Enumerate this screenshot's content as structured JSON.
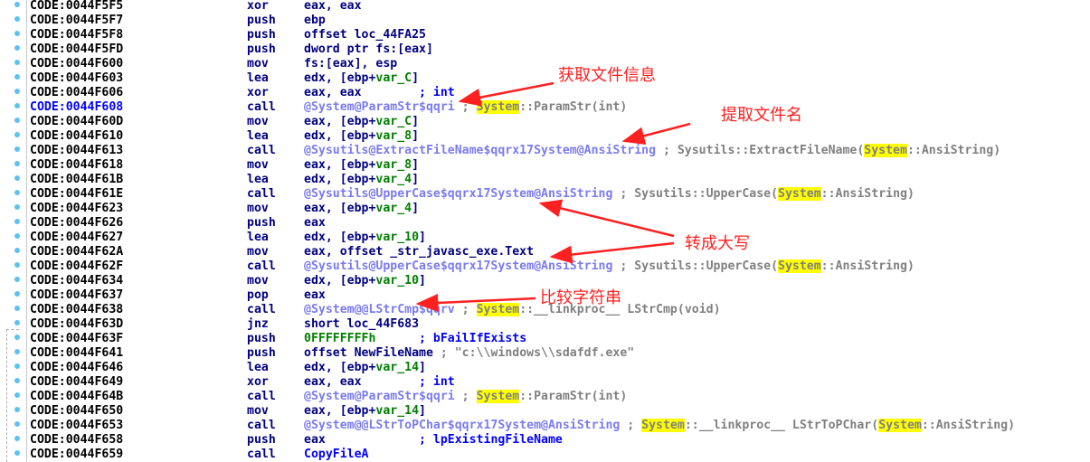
{
  "colors": {
    "annotation": "#ff2020",
    "highlight": "#ffff00",
    "function_ref": "#7b7bf0",
    "comment": "#808080",
    "variable": "#008000",
    "mnemonic": "#000080"
  },
  "rows": [
    {
      "addr": "CODE:0044F5F5",
      "mn": "xor",
      "ops": [
        {
          "t": "eax, eax",
          "c": "op"
        }
      ]
    },
    {
      "addr": "CODE:0044F5F7",
      "mn": "push",
      "ops": [
        {
          "t": "ebp",
          "c": "op"
        }
      ]
    },
    {
      "addr": "CODE:0044F5F8",
      "mn": "push",
      "ops": [
        {
          "t": "offset loc_44FA25",
          "c": "op"
        }
      ]
    },
    {
      "addr": "CODE:0044F5FD",
      "mn": "push",
      "ops": [
        {
          "t": "dword ptr fs:[eax]",
          "c": "op"
        }
      ]
    },
    {
      "addr": "CODE:0044F600",
      "mn": "mov",
      "ops": [
        {
          "t": "fs:[eax], esp",
          "c": "op"
        }
      ]
    },
    {
      "addr": "CODE:0044F603",
      "mn": "lea",
      "ops": [
        {
          "t": "edx, [ebp+",
          "c": "op"
        },
        {
          "t": "var_C",
          "c": "var"
        },
        {
          "t": "]",
          "c": "op"
        }
      ]
    },
    {
      "addr": "CODE:0044F606",
      "mn": "xor",
      "ops": [
        {
          "t": "eax, eax        ",
          "c": "op"
        },
        {
          "t": "; int",
          "c": "cmtb"
        }
      ]
    },
    {
      "addr": "CODE:0044F608",
      "mn": "call",
      "cur": true,
      "ops": [
        {
          "t": "@System@ParamStr$qqri",
          "c": "fn"
        },
        {
          "t": " ; ",
          "c": "cmt"
        },
        {
          "t": "System",
          "c": "hl"
        },
        {
          "t": "::ParamStr(int)",
          "c": "cmt"
        }
      ]
    },
    {
      "addr": "CODE:0044F60D",
      "mn": "mov",
      "ops": [
        {
          "t": "eax, [ebp+",
          "c": "op"
        },
        {
          "t": "var_C",
          "c": "var"
        },
        {
          "t": "]",
          "c": "op"
        }
      ]
    },
    {
      "addr": "CODE:0044F610",
      "mn": "lea",
      "ops": [
        {
          "t": "edx, [ebp+",
          "c": "op"
        },
        {
          "t": "var_8",
          "c": "var"
        },
        {
          "t": "]",
          "c": "op"
        }
      ]
    },
    {
      "addr": "CODE:0044F613",
      "mn": "call",
      "ops": [
        {
          "t": "@Sysutils@ExtractFileName$qqrx17System@AnsiString",
          "c": "fn"
        },
        {
          "t": " ; Sysutils::ExtractFileName(",
          "c": "cmt"
        },
        {
          "t": "System",
          "c": "hl"
        },
        {
          "t": "::AnsiString)",
          "c": "cmt"
        }
      ]
    },
    {
      "addr": "CODE:0044F618",
      "mn": "mov",
      "ops": [
        {
          "t": "eax, [ebp+",
          "c": "op"
        },
        {
          "t": "var_8",
          "c": "var"
        },
        {
          "t": "]",
          "c": "op"
        }
      ]
    },
    {
      "addr": "CODE:0044F61B",
      "mn": "lea",
      "ops": [
        {
          "t": "edx, [ebp+",
          "c": "op"
        },
        {
          "t": "var_4",
          "c": "var"
        },
        {
          "t": "]",
          "c": "op"
        }
      ]
    },
    {
      "addr": "CODE:0044F61E",
      "mn": "call",
      "ops": [
        {
          "t": "@Sysutils@UpperCase$qqrx17System@AnsiString",
          "c": "fn"
        },
        {
          "t": " ; Sysutils::UpperCase(",
          "c": "cmt"
        },
        {
          "t": "System",
          "c": "hl"
        },
        {
          "t": "::AnsiString)",
          "c": "cmt"
        }
      ]
    },
    {
      "addr": "CODE:0044F623",
      "mn": "mov",
      "ops": [
        {
          "t": "eax, [ebp+",
          "c": "op"
        },
        {
          "t": "var_4",
          "c": "var"
        },
        {
          "t": "]",
          "c": "op"
        }
      ]
    },
    {
      "addr": "CODE:0044F626",
      "mn": "push",
      "ops": [
        {
          "t": "eax",
          "c": "op"
        }
      ]
    },
    {
      "addr": "CODE:0044F627",
      "mn": "lea",
      "ops": [
        {
          "t": "edx, [ebp+",
          "c": "op"
        },
        {
          "t": "var_10",
          "c": "var"
        },
        {
          "t": "]",
          "c": "op"
        }
      ]
    },
    {
      "addr": "CODE:0044F62A",
      "mn": "mov",
      "ops": [
        {
          "t": "eax, offset _str_javasc_exe.Text",
          "c": "op"
        }
      ]
    },
    {
      "addr": "CODE:0044F62F",
      "mn": "call",
      "ops": [
        {
          "t": "@Sysutils@UpperCase$qqrx17System@AnsiString",
          "c": "fn"
        },
        {
          "t": " ; Sysutils::UpperCase(",
          "c": "cmt"
        },
        {
          "t": "System",
          "c": "hl"
        },
        {
          "t": "::AnsiString)",
          "c": "cmt"
        }
      ]
    },
    {
      "addr": "CODE:0044F634",
      "mn": "mov",
      "ops": [
        {
          "t": "edx, [ebp+",
          "c": "op"
        },
        {
          "t": "var_10",
          "c": "var"
        },
        {
          "t": "]",
          "c": "op"
        }
      ]
    },
    {
      "addr": "CODE:0044F637",
      "mn": "pop",
      "ops": [
        {
          "t": "eax",
          "c": "op"
        }
      ]
    },
    {
      "addr": "CODE:0044F638",
      "mn": "call",
      "ops": [
        {
          "t": "@System@@LStrCmp$qqrv",
          "c": "fn"
        },
        {
          "t": " ; ",
          "c": "cmt"
        },
        {
          "t": "System",
          "c": "hl"
        },
        {
          "t": "::__linkproc__ LStrCmp(void)",
          "c": "cmt"
        }
      ]
    },
    {
      "addr": "CODE:0044F63D",
      "mn": "jnz",
      "ops": [
        {
          "t": "short loc_44F683",
          "c": "op"
        }
      ]
    },
    {
      "addr": "CODE:0044F63F",
      "mn": "push",
      "ops": [
        {
          "t": "0FFFFFFFFh",
          "c": "num"
        },
        {
          "t": "      ",
          "c": "op"
        },
        {
          "t": "; bFailIfExists",
          "c": "cmtb"
        }
      ]
    },
    {
      "addr": "CODE:0044F641",
      "mn": "push",
      "ops": [
        {
          "t": "offset NewFileName",
          "c": "op"
        },
        {
          "t": " ; \"c:\\\\windows\\\\sdafdf.exe\"",
          "c": "cmt"
        }
      ]
    },
    {
      "addr": "CODE:0044F646",
      "mn": "lea",
      "ops": [
        {
          "t": "edx, [ebp+",
          "c": "op"
        },
        {
          "t": "var_14",
          "c": "var"
        },
        {
          "t": "]",
          "c": "op"
        }
      ]
    },
    {
      "addr": "CODE:0044F649",
      "mn": "xor",
      "ops": [
        {
          "t": "eax, eax        ",
          "c": "op"
        },
        {
          "t": "; int",
          "c": "cmtb"
        }
      ]
    },
    {
      "addr": "CODE:0044F64B",
      "mn": "call",
      "ops": [
        {
          "t": "@System@ParamStr$qqri",
          "c": "fn"
        },
        {
          "t": " ; ",
          "c": "cmt"
        },
        {
          "t": "System",
          "c": "hl"
        },
        {
          "t": "::ParamStr(int)",
          "c": "cmt"
        }
      ]
    },
    {
      "addr": "CODE:0044F650",
      "mn": "mov",
      "ops": [
        {
          "t": "eax, [ebp+",
          "c": "op"
        },
        {
          "t": "var_14",
          "c": "var"
        },
        {
          "t": "]",
          "c": "op"
        }
      ]
    },
    {
      "addr": "CODE:0044F653",
      "mn": "call",
      "ops": [
        {
          "t": "@System@@LStrToPChar$qqrx17System@AnsiString",
          "c": "fn"
        },
        {
          "t": " ; ",
          "c": "cmt"
        },
        {
          "t": "System",
          "c": "hl"
        },
        {
          "t": "::__linkproc__ LStrToPChar(",
          "c": "cmt"
        },
        {
          "t": "System",
          "c": "hl"
        },
        {
          "t": "::AnsiString)",
          "c": "cmt"
        }
      ]
    },
    {
      "addr": "CODE:0044F658",
      "mn": "push",
      "ops": [
        {
          "t": "eax             ",
          "c": "op"
        },
        {
          "t": "; lpExistingFileName",
          "c": "cmtb"
        }
      ]
    },
    {
      "addr": "CODE:0044F659",
      "mn": "call",
      "ops": [
        {
          "t": "CopyFileA",
          "c": "api"
        }
      ]
    }
  ],
  "annotations": {
    "get_file_info": "获取文件信息",
    "extract_filename": "提取文件名",
    "to_uppercase": "转成大写",
    "compare_strings": "比较字符串"
  }
}
